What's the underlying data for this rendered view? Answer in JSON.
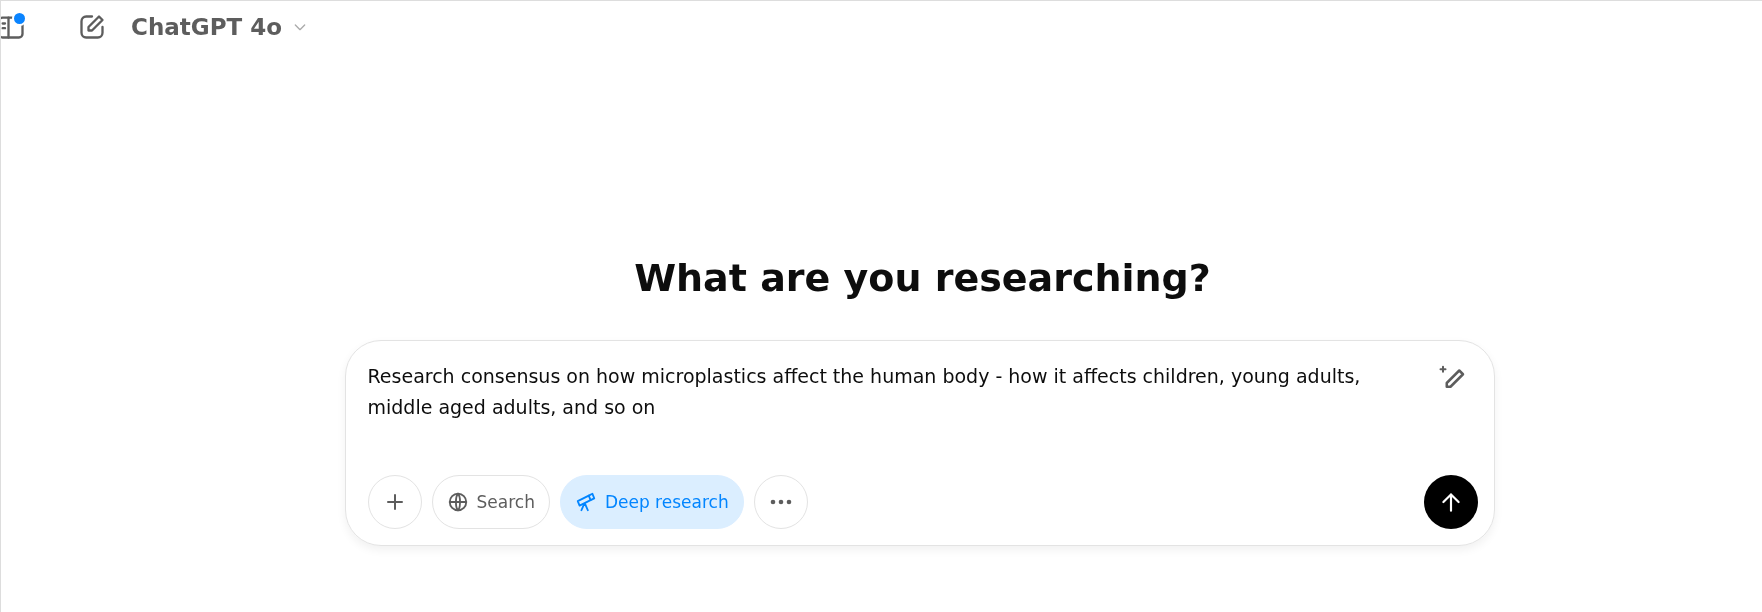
{
  "header": {
    "model": "ChatGPT 4o",
    "notification": true
  },
  "heading": "What are you researching?",
  "composer": {
    "value": "Research consensus on how microplastics affect the human body - how it affects children, young adults, middle aged adults, and so on",
    "tools": [
      {
        "kind": "add"
      },
      {
        "kind": "search",
        "label": "Search",
        "selected": false
      },
      {
        "kind": "research",
        "label": "Deep research",
        "selected": true
      },
      {
        "kind": "more"
      }
    ]
  }
}
